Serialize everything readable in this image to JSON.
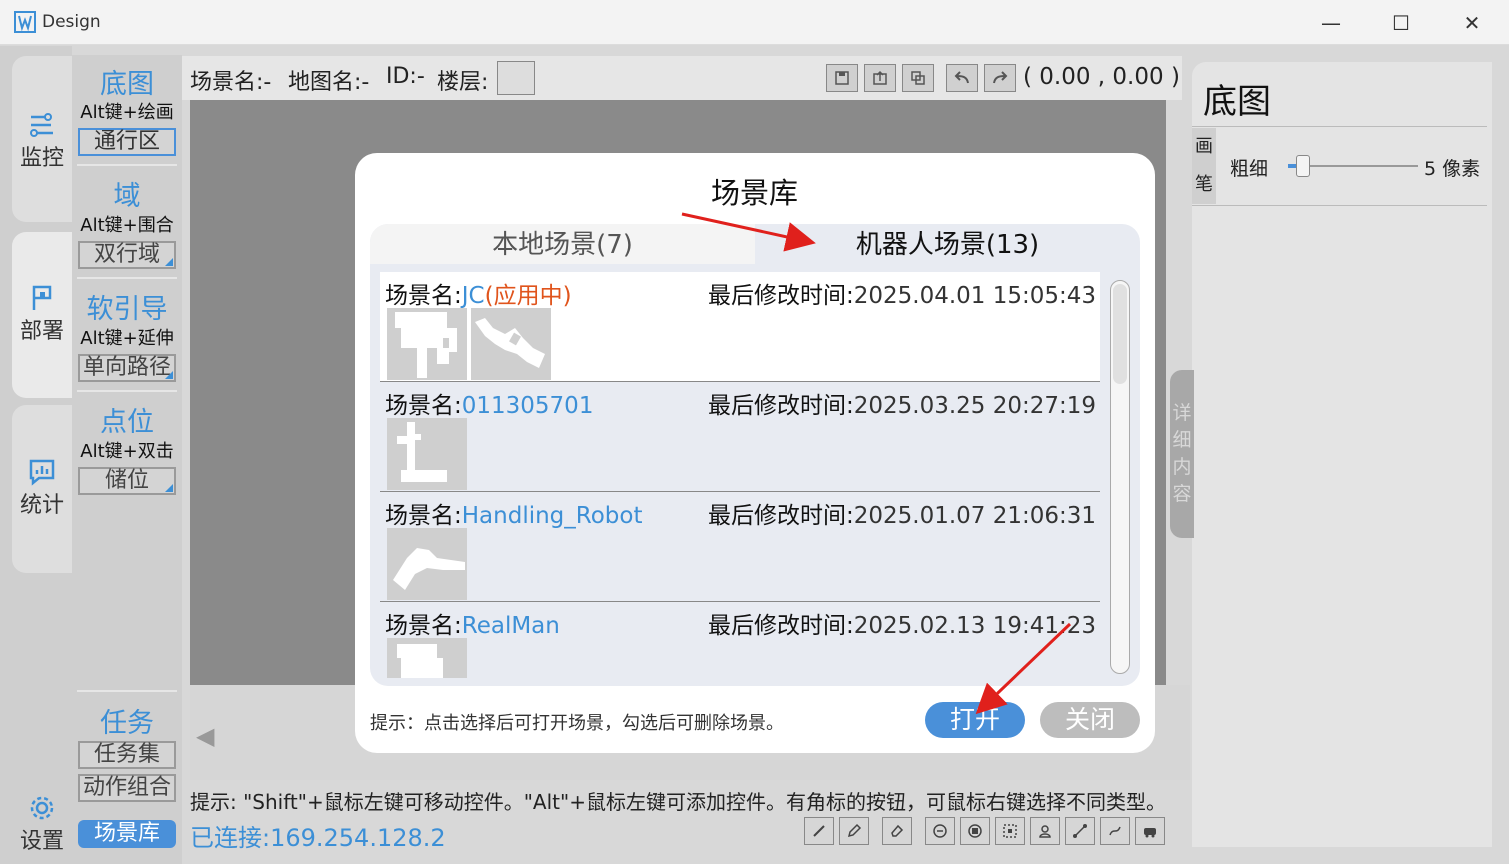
{
  "window": {
    "title": "Design",
    "minimize": "—",
    "maximize": "☐",
    "close": "✕"
  },
  "nav": {
    "monitor": "监控",
    "deploy": "部署",
    "stats": "统计",
    "settings": "设置"
  },
  "tools": {
    "basemap": {
      "title": "底图",
      "hint": "Alt键+绘画",
      "button": "通行区"
    },
    "domain": {
      "title": "域",
      "hint": "Alt键+围合",
      "button": "双行域"
    },
    "soft_guide": {
      "title": "软引导",
      "hint": "Alt键+延伸",
      "button": "单向路径"
    },
    "point": {
      "title": "点位",
      "hint": "Alt键+双击",
      "button": "储位"
    },
    "task": {
      "title": "任务",
      "button1": "任务集",
      "button2": "动作组合"
    },
    "scene_lib_button": "场景库"
  },
  "infobar": {
    "scene": "场景名:-",
    "map": "地图名:-",
    "id": "ID:-",
    "floor": "楼层:",
    "coords": "( 0.00 , 0.00 )"
  },
  "hint": "提示: \"Shift\"+鼠标左键可移动控件。\"Alt\"+鼠标左键可添加控件。有角标的按钮，可鼠标右键选择不同类型。",
  "status": "已连接:169.254.128.2",
  "right_panel": {
    "title": "底图",
    "pen_label": "画笔",
    "pen1": "画",
    "pen2": "笔",
    "thickness_label": "粗细",
    "thickness_value": "5 像素",
    "thickness_fraction": 0.05,
    "detail_tab": "详细内容"
  },
  "modal": {
    "title": "场景库",
    "tab_local": "本地场景(7)",
    "tab_robot": "机器人场景(13)",
    "name_label": "场景名:",
    "time_label": "最后修改时间:",
    "scenes": [
      {
        "name": "JC",
        "status": "(应用中)",
        "time": "2025.04.01 15:05:43"
      },
      {
        "name": "011305701",
        "status": "",
        "time": "2025.03.25 20:27:19"
      },
      {
        "name": "Handling_Robot",
        "status": "",
        "time": "2025.01.07 21:06:31"
      },
      {
        "name": "RealMan",
        "status": "",
        "time": "2025.02.13 19:41:23"
      }
    ],
    "tip": "提示：点击选择后可打开场景，勾选后可删除场景。",
    "open_button": "打开",
    "close_button": "关闭"
  },
  "colors": {
    "accent": "#4a90d9",
    "link": "#3c8fd6",
    "active_status": "#e0541c",
    "annotation": "#e0201c"
  }
}
